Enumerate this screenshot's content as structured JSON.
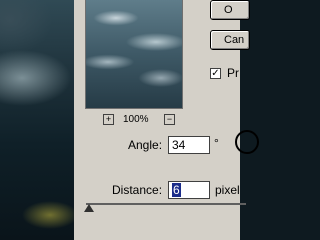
{
  "dialog": {
    "preview": {
      "zoom_label": "100%",
      "zoom_in": "+",
      "zoom_out": "−"
    },
    "buttons": {
      "ok_partial": "O",
      "cancel_partial": "Can"
    },
    "preview_checkbox": {
      "label_partial": "Pr",
      "checked": true,
      "mark": "✓"
    },
    "angle": {
      "label": "Angle:",
      "value": "34",
      "unit": "°"
    },
    "distance": {
      "label": "Distance:",
      "value": "6",
      "unit": "pixel"
    },
    "slider_level": "6 pixels (minimum side)"
  }
}
